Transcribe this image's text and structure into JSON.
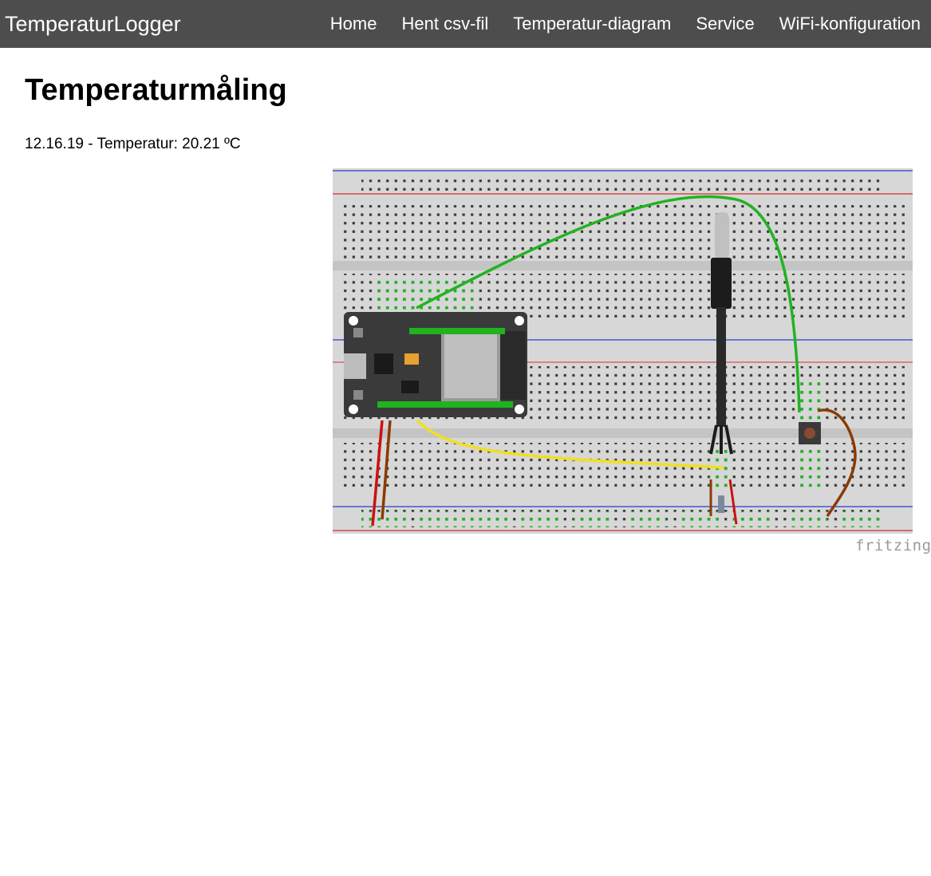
{
  "nav": {
    "brand": "TemperaturLogger",
    "links": [
      "Home",
      "Hent csv-fil",
      "Temperatur-diagram",
      "Service",
      "WiFi-konfiguration"
    ]
  },
  "main": {
    "title": "Temperaturmåling",
    "reading": "12.16.19 - Temperatur: 20.21 ºC"
  },
  "figure": {
    "credit": "fritzing",
    "colors": {
      "board": "#dcdcdc",
      "strip": "#c8c8c8",
      "rail_blue": "#2b3cc8",
      "rail_red": "#d63030",
      "esp32": "#3a3a3a",
      "wire_green": "#22b322",
      "wire_yellow": "#f0e020",
      "wire_red": "#cc1111",
      "wire_brown": "#8b3a00",
      "sensor": "#1c1c1c",
      "probe": "#c0c0c0"
    }
  }
}
